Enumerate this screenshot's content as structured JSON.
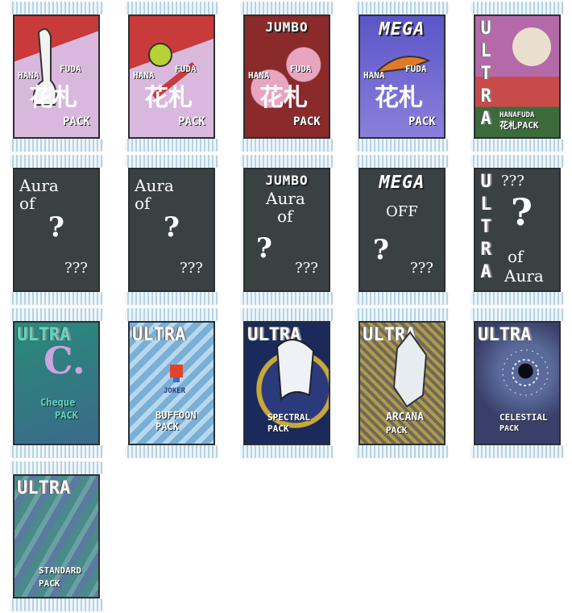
{
  "packs": [
    {
      "tag": "",
      "h1": "HANA",
      "h2": "FUDA",
      "kanji": "花札",
      "pack": "PACK"
    },
    {
      "tag": "",
      "h1": "HANA",
      "h2": "FUDA",
      "kanji": "花札",
      "pack": "PACK"
    },
    {
      "tag": "JUMBO",
      "h1": "HANA",
      "h2": "FUDA",
      "kanji": "花札",
      "pack": "PACK"
    },
    {
      "tag": "MEGA",
      "h1": "HANA",
      "h2": "FUDA",
      "kanji": "花札",
      "pack": "PACK"
    },
    {
      "tag": "ULTRA",
      "sub": "HANAFUDA",
      "pack": "花札PACK"
    },
    {
      "tag": "",
      "line1": "Aura",
      "line2": "of",
      "q": "?",
      "qq": "???"
    },
    {
      "tag": "",
      "line1": "Aura",
      "line2": "of",
      "q": "?",
      "qq": "???"
    },
    {
      "tag": "JUMBO",
      "line1": "Aura",
      "line2": "of",
      "q": "?",
      "qq": "???"
    },
    {
      "tag": "MEGA",
      "line1": "OFF",
      "q": "?",
      "qq": "???"
    },
    {
      "tag": "ULTRA",
      "qq": "???",
      "q": "?",
      "line1": "of",
      "line2": "Aura"
    },
    {
      "tag": "ULTRA",
      "c": "C.",
      "name": "Cheque",
      "pack": "PACK"
    },
    {
      "tag": "ULTRA",
      "logo": "JOKER",
      "name": "BUFFOON",
      "pack": "PACK"
    },
    {
      "tag": "ULTRA",
      "name": "SPECTRAL",
      "pack": "PACK"
    },
    {
      "tag": "ULTRA",
      "name": "ARCANA",
      "pack": "PACK"
    },
    {
      "tag": "ULTRA",
      "name": "CELESTIAL",
      "pack": "PACK"
    },
    {
      "tag": "ULTRA",
      "name": "STANDARD",
      "pack": "PACK"
    }
  ]
}
